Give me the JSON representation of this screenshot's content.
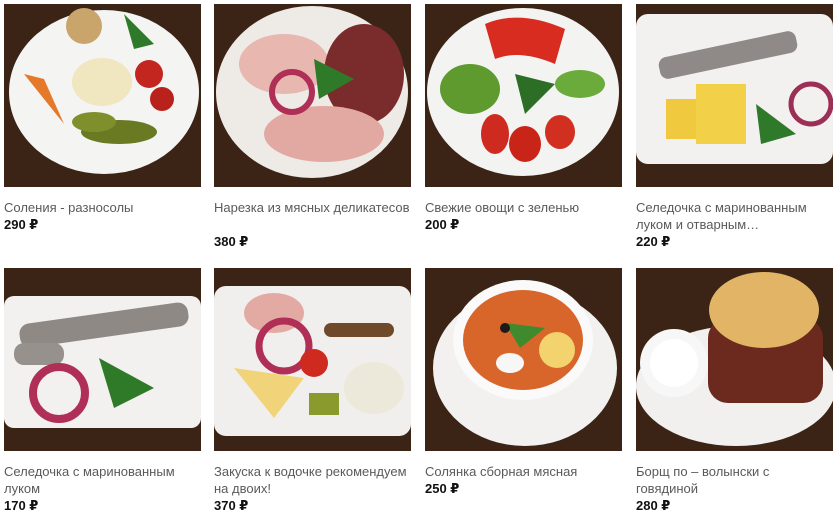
{
  "menu": {
    "items": [
      {
        "name": "Соления - разносолы",
        "price": "290 ₽"
      },
      {
        "name": "Нарезка из мясных деликатесов",
        "price": "380 ₽"
      },
      {
        "name": "Свежие овощи с зеленью",
        "price": "200 ₽"
      },
      {
        "name": "Селедочка с маринованным луком и отварным…",
        "price": "220 ₽"
      },
      {
        "name": "Селедочка с маринованным луком",
        "price": "170 ₽"
      },
      {
        "name": "Закуска к водочке рекомендуем на двоих!",
        "price": "370 ₽"
      },
      {
        "name": "Солянка сборная мясная",
        "price": "250 ₽"
      },
      {
        "name": "Борщ по – волынски с говядиной",
        "price": "280 ₽"
      }
    ]
  }
}
